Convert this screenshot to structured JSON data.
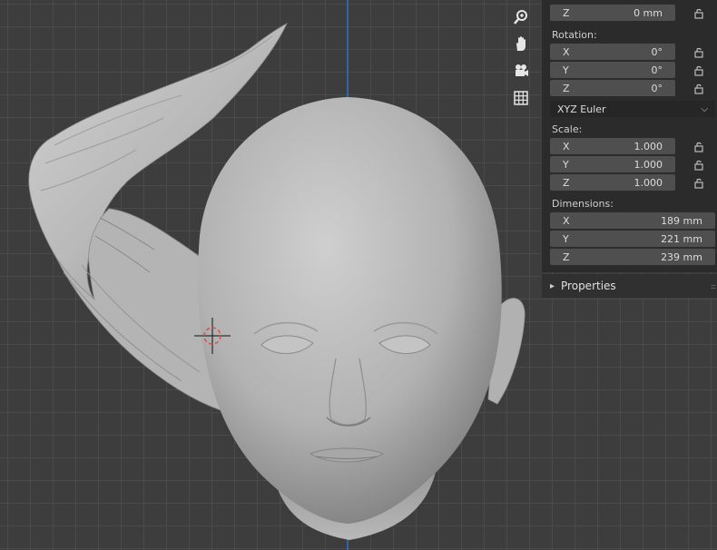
{
  "transform": {
    "location": {
      "z": {
        "axis": "Z",
        "value": "0 mm"
      }
    },
    "rotation": {
      "label": "Rotation:",
      "x": {
        "axis": "X",
        "value": "0°"
      },
      "y": {
        "axis": "Y",
        "value": "0°"
      },
      "z": {
        "axis": "Z",
        "value": "0°"
      },
      "mode": "XYZ Euler"
    },
    "scale": {
      "label": "Scale:",
      "x": {
        "axis": "X",
        "value": "1.000"
      },
      "y": {
        "axis": "Y",
        "value": "1.000"
      },
      "z": {
        "axis": "Z",
        "value": "1.000"
      }
    },
    "dimensions": {
      "label": "Dimensions:",
      "x": {
        "axis": "X",
        "value": "189 mm"
      },
      "y": {
        "axis": "Y",
        "value": "221 mm"
      },
      "z": {
        "axis": "Z",
        "value": "239 mm"
      }
    }
  },
  "properties": {
    "label": "Properties",
    "arrow": "▸"
  },
  "viewport_tools": [
    "zoom-icon",
    "hand-pan-icon",
    "camera-icon",
    "grid-view-icon"
  ],
  "colors": {
    "viewport_bg": "#3d3d3d",
    "grid_line": "#4a4a4a",
    "panel_bg": "#2b2b2b",
    "field_bg": "#4f4f4f",
    "z_axis": "#2f6fc9",
    "mesh": "#a9a9a9"
  }
}
